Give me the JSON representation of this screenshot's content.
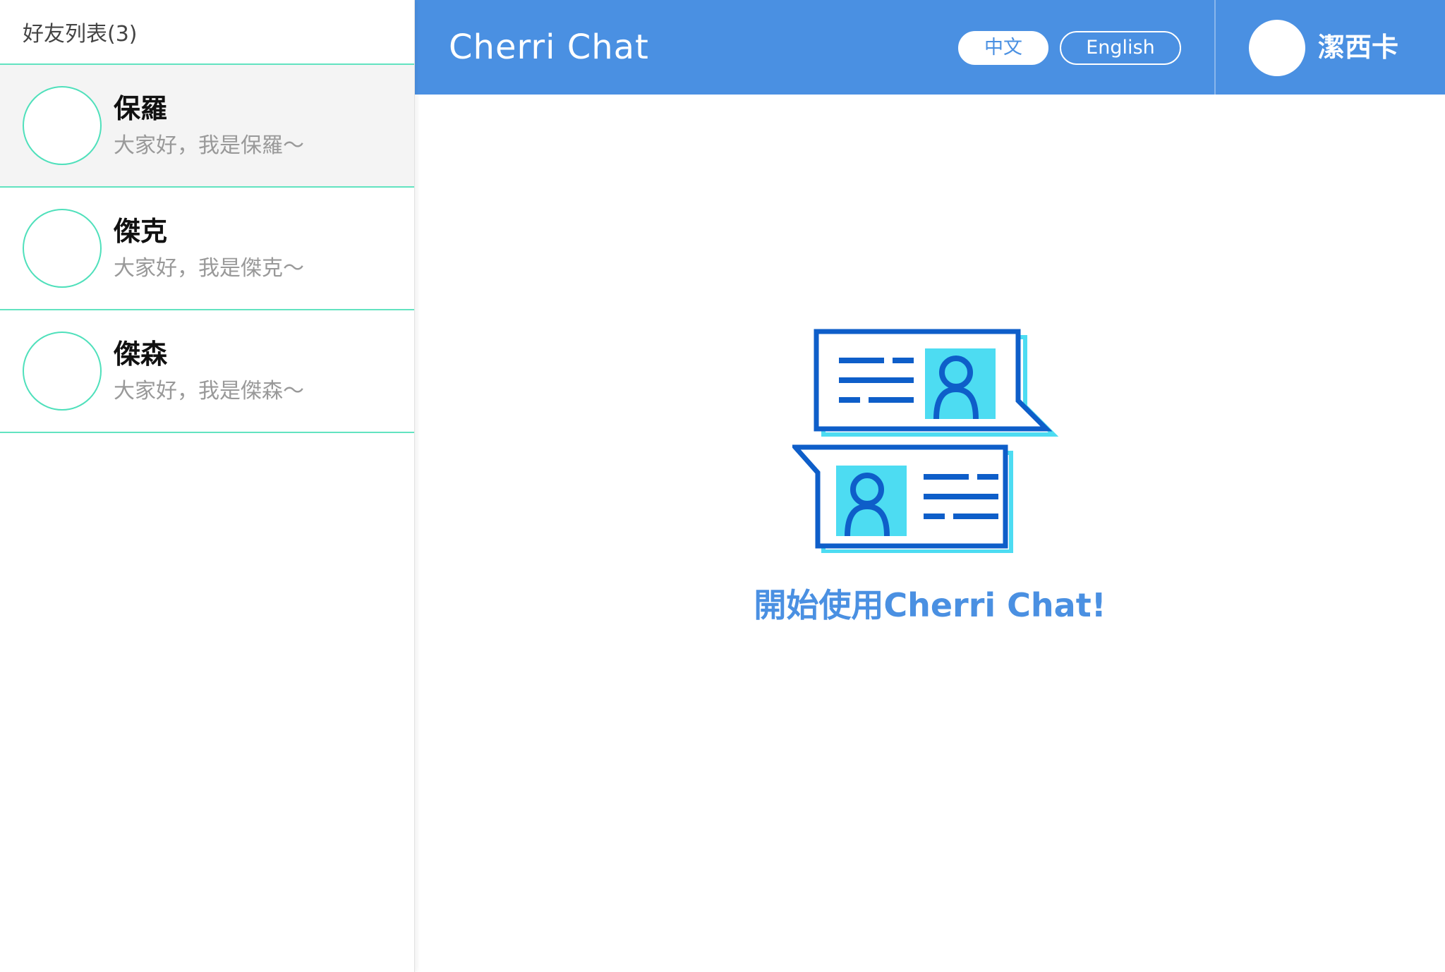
{
  "sidebar": {
    "title": "好友列表(3)",
    "friends": [
      {
        "name": "保羅",
        "status": "大家好，我是保羅～"
      },
      {
        "name": "傑克",
        "status": "大家好，我是傑克～"
      },
      {
        "name": "傑森",
        "status": "大家好，我是傑森～"
      }
    ]
  },
  "header": {
    "brand": "Cherri Chat",
    "lang_zh": "中文",
    "lang_en": "English",
    "user_name": "潔西卡"
  },
  "main": {
    "illustration_icon": "chat-bubbles-icon",
    "welcome": "開始使用Cherri Chat!"
  },
  "colors": {
    "primary": "#4a90e2",
    "accent_green": "#62e3c0",
    "icon_dark_blue": "#0e5ec9",
    "icon_cyan": "#4ddcf2"
  }
}
